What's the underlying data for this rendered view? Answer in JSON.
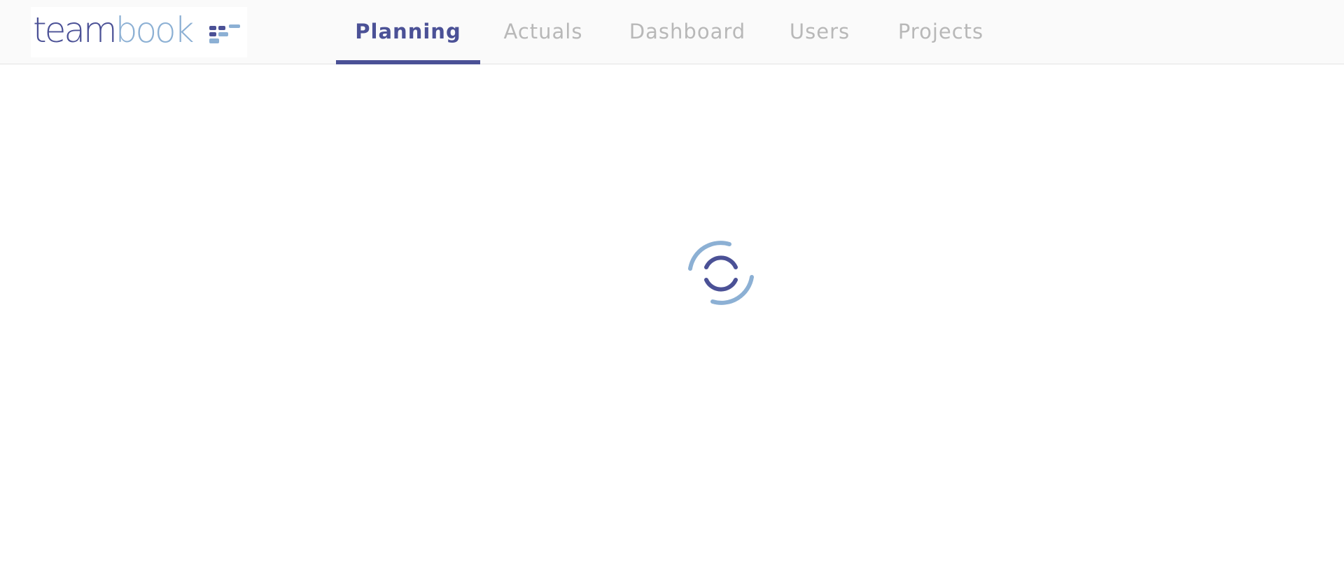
{
  "app": {
    "brand": {
      "part1": "team",
      "part2": "book"
    }
  },
  "nav": {
    "tabs": [
      {
        "label": "Planning",
        "active": true
      },
      {
        "label": "Actuals",
        "active": false
      },
      {
        "label": "Dashboard",
        "active": false
      },
      {
        "label": "Users",
        "active": false
      },
      {
        "label": "Projects",
        "active": false
      }
    ]
  },
  "main": {
    "state": "loading",
    "spinner_icon": "loading-spinner-icon"
  },
  "colors": {
    "brand_primary": "#4b5196",
    "brand_secondary": "#8cb0d4",
    "tab_inactive": "#b8b8b8",
    "header_bg": "#fafafa"
  }
}
